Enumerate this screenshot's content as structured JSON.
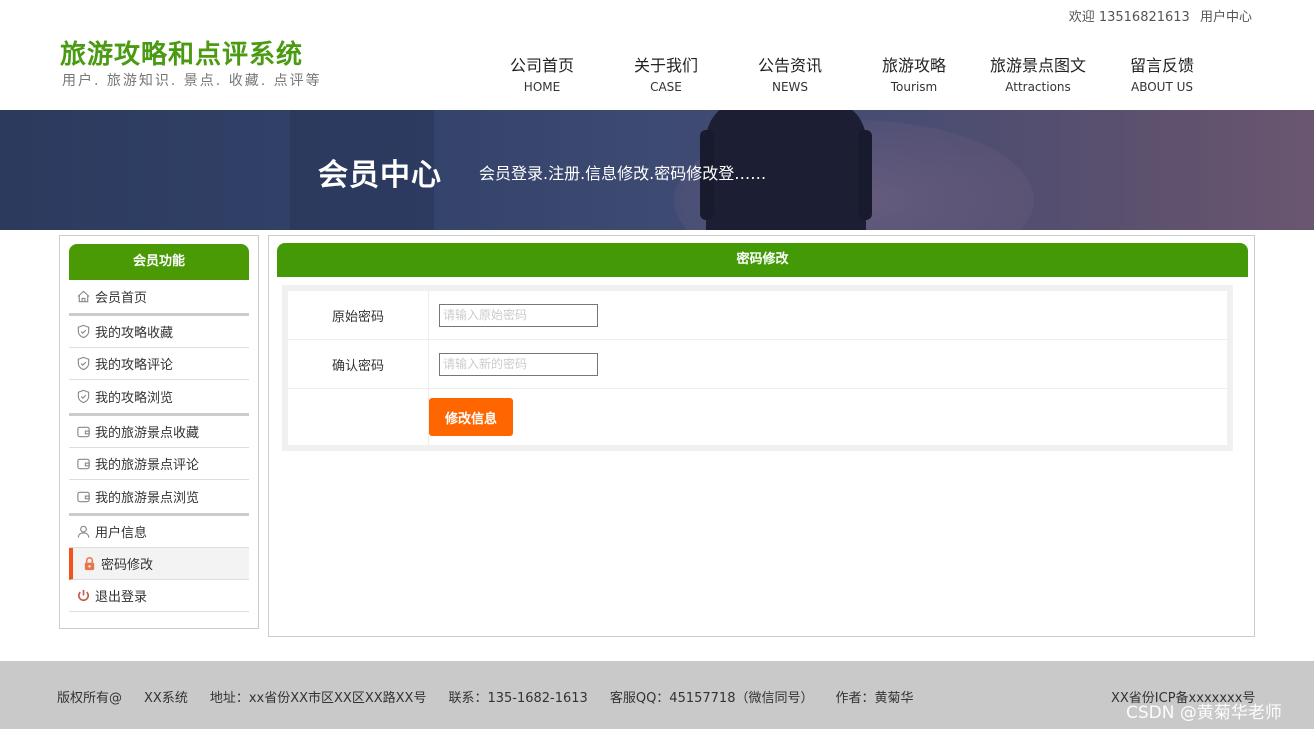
{
  "topbar": {
    "welcome": "欢迎 13516821613",
    "user_center": "用户中心"
  },
  "logo": {
    "title": "旅游攻略和点评系统",
    "subtitle": "用户. 旅游知识. 景点. 收藏. 点评等"
  },
  "nav": [
    {
      "cn": "公司首页",
      "en": "HOME"
    },
    {
      "cn": "关于我们",
      "en": "CASE"
    },
    {
      "cn": "公告资讯",
      "en": "NEWS"
    },
    {
      "cn": "旅游攻略",
      "en": "Tourism"
    },
    {
      "cn": "旅游景点图文",
      "en": "Attractions"
    },
    {
      "cn": "留言反馈",
      "en": "ABOUT US"
    }
  ],
  "banner": {
    "title": "会员中心",
    "desc": "会员登录.注册.信息修改.密码修改登……"
  },
  "sidebar": {
    "header": "会员功能",
    "items": [
      {
        "label": "会员首页",
        "icon": "home-icon"
      },
      {
        "label": "我的攻略收藏",
        "icon": "shield-icon"
      },
      {
        "label": "我的攻略评论",
        "icon": "shield-icon"
      },
      {
        "label": "我的攻略浏览",
        "icon": "shield-icon"
      },
      {
        "label": "我的旅游景点收藏",
        "icon": "wallet-icon"
      },
      {
        "label": "我的旅游景点评论",
        "icon": "wallet-icon"
      },
      {
        "label": "我的旅游景点浏览",
        "icon": "wallet-icon"
      },
      {
        "label": "用户信息",
        "icon": "user-icon"
      },
      {
        "label": "密码修改",
        "icon": "lock-icon"
      },
      {
        "label": "退出登录",
        "icon": "power-icon"
      }
    ]
  },
  "main": {
    "header": "密码修改",
    "form": {
      "old_password_label": "原始密码",
      "old_password_placeholder": "请输入原始密码",
      "new_password_label": "确认密码",
      "new_password_placeholder": "请输入新的密码",
      "submit_label": "修改信息"
    }
  },
  "footer": {
    "copyright": "版权所有@",
    "system": "XX系统",
    "address": "地址：xx省份XX市区XX区XX路XX号",
    "contact": "联系：135-1682-1613",
    "qq": "客服QQ：45157718（微信同号）",
    "author": "作者：黄菊华",
    "icp": "XX省份ICP备xxxxxxx号",
    "watermark": "CSDN @黄菊华老师"
  },
  "colors": {
    "brand_green": "#4a9a06",
    "accent_orange": "#ff6600",
    "active_marker": "#f4511e"
  }
}
